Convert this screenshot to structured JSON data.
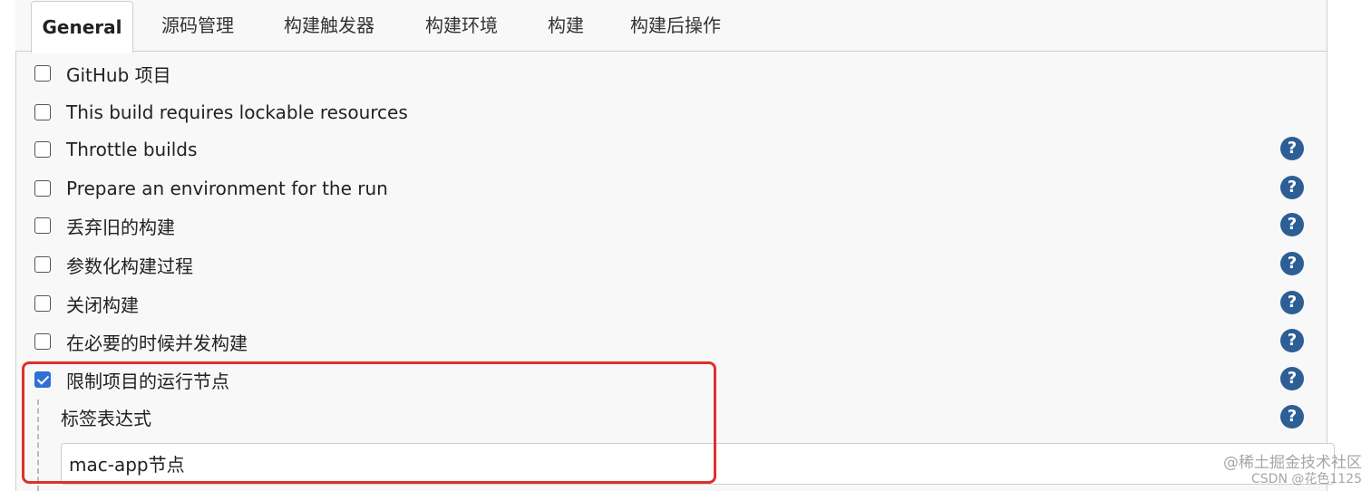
{
  "tabs": [
    {
      "label": "General",
      "active": true
    },
    {
      "label": "源码管理",
      "active": false
    },
    {
      "label": "构建触发器",
      "active": false
    },
    {
      "label": "构建环境",
      "active": false
    },
    {
      "label": "构建",
      "active": false
    },
    {
      "label": "构建后操作",
      "active": false
    }
  ],
  "options": [
    {
      "label": "GitHub 项目",
      "checked": false,
      "help": false
    },
    {
      "label": "This build requires lockable resources",
      "checked": false,
      "help": false
    },
    {
      "label": "Throttle builds",
      "checked": false,
      "help": true
    },
    {
      "label": "Prepare an environment for the run",
      "checked": false,
      "help": true
    },
    {
      "label": "丢弃旧的构建",
      "checked": false,
      "help": true
    },
    {
      "label": "参数化构建过程",
      "checked": false,
      "help": true
    },
    {
      "label": "关闭构建",
      "checked": false,
      "help": true
    },
    {
      "label": "在必要的时候并发构建",
      "checked": false,
      "help": true
    },
    {
      "label": "限制项目的运行节点",
      "checked": true,
      "help": true
    }
  ],
  "label_expression": {
    "label": "标签表达式",
    "value": "mac-app节点"
  },
  "help_glyph": "?",
  "watermark": {
    "line1": "@稀土掘金技术社区",
    "line2": "CSDN @花色1125"
  },
  "colors": {
    "help_icon": "#2d5e95",
    "checkbox_checked": "#2f6fd6",
    "highlight_box": "#e0302a"
  }
}
